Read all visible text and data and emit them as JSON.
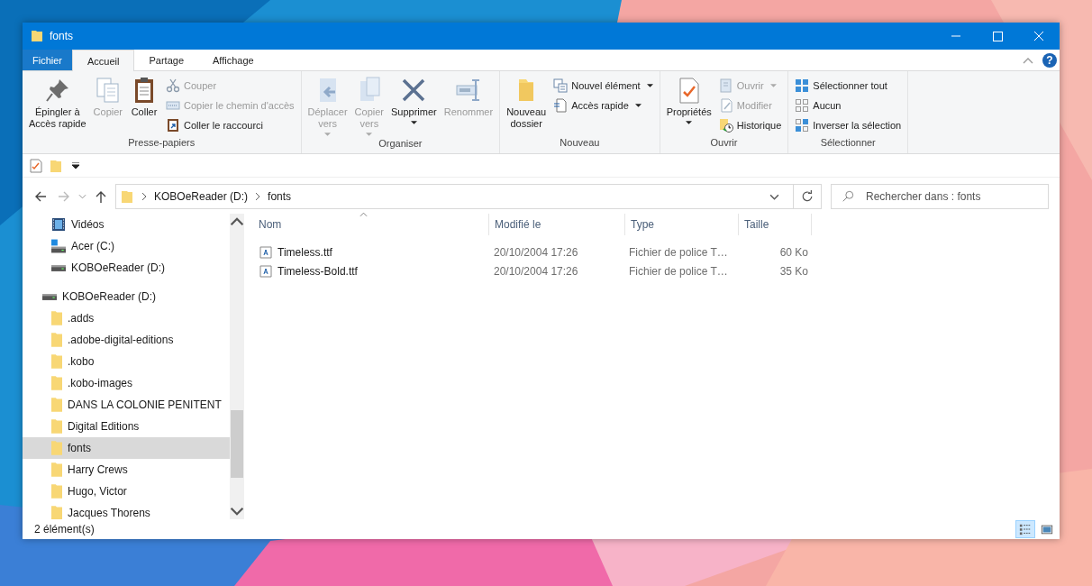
{
  "window": {
    "title": "fonts"
  },
  "ribbon": {
    "tabs": [
      {
        "label": "Fichier",
        "kind": "file",
        "selected": false
      },
      {
        "label": "Accueil",
        "kind": "tab",
        "selected": true
      },
      {
        "label": "Partage",
        "kind": "tab",
        "selected": false
      },
      {
        "label": "Affichage",
        "kind": "tab",
        "selected": false
      }
    ],
    "help": "?",
    "groups": [
      {
        "label": "Presse-papiers",
        "items": [
          {
            "label": "Épingler à\nAccès rapide",
            "kind": "pin",
            "large": true,
            "disabled": false,
            "dropdown": false
          },
          {
            "label": "Copier",
            "kind": "copy",
            "large": true,
            "disabled": true,
            "dropdown": false
          },
          {
            "label": "Coller",
            "kind": "paste",
            "large": true,
            "disabled": false,
            "dropdown": false
          },
          {
            "label": "Couper",
            "kind": "cut",
            "large": false,
            "disabled": true,
            "dropdown": false
          },
          {
            "label": "Copier le chemin d'accès",
            "kind": "path",
            "large": false,
            "disabled": true,
            "dropdown": false
          },
          {
            "label": "Coller le raccourci",
            "kind": "shortcut",
            "large": false,
            "disabled": false,
            "dropdown": false
          }
        ]
      },
      {
        "label": "Organiser",
        "items": [
          {
            "label": "Déplacer\nvers",
            "kind": "move",
            "large": true,
            "disabled": true,
            "dropdown": true
          },
          {
            "label": "Copier\nvers",
            "kind": "copyto",
            "large": true,
            "disabled": true,
            "dropdown": true
          },
          {
            "label": "Supprimer",
            "kind": "delete",
            "large": true,
            "disabled": false,
            "dropdown": true
          },
          {
            "label": "Renommer",
            "kind": "rename",
            "large": true,
            "disabled": true,
            "dropdown": false
          }
        ]
      },
      {
        "label": "Nouveau",
        "items": [
          {
            "label": "Nouveau\ndossier",
            "kind": "folder",
            "large": true,
            "disabled": false,
            "dropdown": false
          },
          {
            "label": "Nouvel élément",
            "kind": "newitem",
            "large": false,
            "disabled": false,
            "dropdown": true
          },
          {
            "label": "Accès rapide",
            "kind": "quick",
            "large": false,
            "disabled": false,
            "dropdown": true
          }
        ]
      },
      {
        "label": "Ouvrir",
        "items": [
          {
            "label": "Propriétés",
            "kind": "props",
            "large": true,
            "disabled": false,
            "dropdown": true
          },
          {
            "label": "Ouvrir",
            "kind": "open",
            "large": false,
            "disabled": true,
            "dropdown": true
          },
          {
            "label": "Modifier",
            "kind": "edit",
            "large": false,
            "disabled": true,
            "dropdown": false
          },
          {
            "label": "Historique",
            "kind": "history",
            "large": false,
            "disabled": false,
            "dropdown": false
          }
        ]
      },
      {
        "label": "Sélectionner",
        "items": [
          {
            "label": "Sélectionner tout",
            "kind": "selectall",
            "large": false,
            "disabled": false,
            "dropdown": false
          },
          {
            "label": "Aucun",
            "kind": "none",
            "large": false,
            "disabled": false,
            "dropdown": false
          },
          {
            "label": "Inverser la sélection",
            "kind": "invert",
            "large": false,
            "disabled": false,
            "dropdown": false
          }
        ]
      }
    ]
  },
  "address": {
    "crumbs": [
      "KOBOeReader (D:)",
      "fonts"
    ],
    "search_placeholder": "Rechercher dans : fonts"
  },
  "nav": {
    "items": [
      {
        "label": "Vidéos",
        "kind": "videos",
        "selected": false
      },
      {
        "label": "Acer (C:)",
        "kind": "windrive",
        "selected": false
      },
      {
        "label": "KOBOeReader (D:)",
        "kind": "drive",
        "selected": false
      },
      {
        "label": "KOBOeReader (D:)",
        "kind": "drive",
        "selected": false,
        "children": [
          {
            "label": ".adds",
            "kind": "folder",
            "selected": false
          },
          {
            "label": ".adobe-digital-editions",
            "kind": "folder",
            "selected": false
          },
          {
            "label": ".kobo",
            "kind": "folder",
            "selected": false
          },
          {
            "label": ".kobo-images",
            "kind": "folder",
            "selected": false
          },
          {
            "label": "DANS LA COLONIE PENITENT",
            "kind": "folder",
            "selected": false
          },
          {
            "label": "Digital Editions",
            "kind": "folder",
            "selected": false
          },
          {
            "label": "fonts",
            "kind": "folder",
            "selected": true
          },
          {
            "label": "Harry Crews",
            "kind": "folder",
            "selected": false
          },
          {
            "label": "Hugo, Victor",
            "kind": "folder",
            "selected": false
          },
          {
            "label": "Jacques Thorens",
            "kind": "folder",
            "selected": false
          }
        ]
      }
    ]
  },
  "table": {
    "columns": [
      "Nom",
      "Modifié le",
      "Type",
      "Taille"
    ],
    "rows": [
      {
        "name": "Timeless.ttf",
        "modified": "20/10/2004 17:26",
        "type": "Fichier de police T…",
        "size": "60 Ko"
      },
      {
        "name": "Timeless-Bold.ttf",
        "modified": "20/10/2004 17:26",
        "type": "Fichier de police T…",
        "size": "35 Ko"
      }
    ]
  },
  "status_bar": {
    "text": "2 élément(s)",
    "views": [
      {
        "kind": "details",
        "selected": true
      },
      {
        "kind": "tiles",
        "selected": false
      }
    ]
  }
}
